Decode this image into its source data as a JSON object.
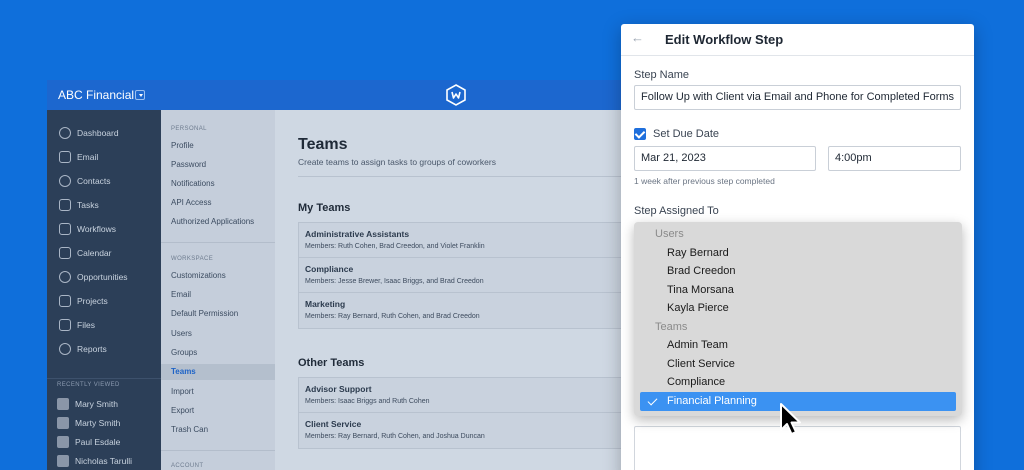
{
  "app": {
    "name": "ABC Financial"
  },
  "nav": {
    "items": [
      "Dashboard",
      "Email",
      "Contacts",
      "Tasks",
      "Workflows",
      "Calendar",
      "Opportunities",
      "Projects",
      "Files",
      "Reports"
    ],
    "recent_label": "RECENTLY VIEWED",
    "recent": [
      "Mary Smith",
      "Marty Smith",
      "Paul Esdale",
      "Nicholas Tarulli"
    ]
  },
  "settings": {
    "personal_label": "PERSONAL",
    "personal": [
      "Profile",
      "Password",
      "Notifications",
      "API Access",
      "Authorized Applications"
    ],
    "workspace_label": "WORKSPACE",
    "workspace": [
      "Customizations",
      "Email",
      "Default Permission",
      "Users",
      "Groups",
      "Teams",
      "Import",
      "Export",
      "Trash Can"
    ],
    "account_label": "ACCOUNT",
    "active": "Teams"
  },
  "main": {
    "title": "Teams",
    "subtitle": "Create teams to assign tasks to groups of coworkers",
    "my_teams_label": "My Teams",
    "my_teams": [
      {
        "name": "Administrative Assistants",
        "members": "Members: Ruth Cohen, Brad Creedon, and Violet Franklin"
      },
      {
        "name": "Compliance",
        "members": "Members: Jesse Brewer, Isaac Briggs, and Brad Creedon"
      },
      {
        "name": "Marketing",
        "members": "Members: Ray Bernard, Ruth Cohen, and Brad Creedon"
      }
    ],
    "other_teams_label": "Other Teams",
    "other_teams": [
      {
        "name": "Advisor Support",
        "members": "Members: Isaac Briggs and Ruth Cohen"
      },
      {
        "name": "Client Service",
        "members": "Members: Ray Bernard, Ruth Cohen, and Joshua Duncan"
      }
    ]
  },
  "panel": {
    "title": "Edit Workflow Step",
    "step_name_label": "Step Name",
    "step_name_value": "Follow Up with Client via Email and Phone for Completed Forms",
    "due_date_label": "Set Due Date",
    "due_date_checked": true,
    "date_value": "Mar 21, 2023",
    "time_value": "4:00pm",
    "due_hint": "1 week after previous step completed",
    "assigned_label": "Step Assigned To"
  },
  "dropdown": {
    "users_label": "Users",
    "users": [
      "Ray Bernard",
      "Brad Creedon",
      "Tina Morsana",
      "Kayla Pierce"
    ],
    "teams_label": "Teams",
    "teams": [
      "Admin Team",
      "Client Service",
      "Compliance"
    ],
    "selected": "Financial Planning"
  },
  "colors": {
    "background": "#0f6fdb",
    "accent": "#1f6fdc",
    "selection": "#3b92f2"
  }
}
